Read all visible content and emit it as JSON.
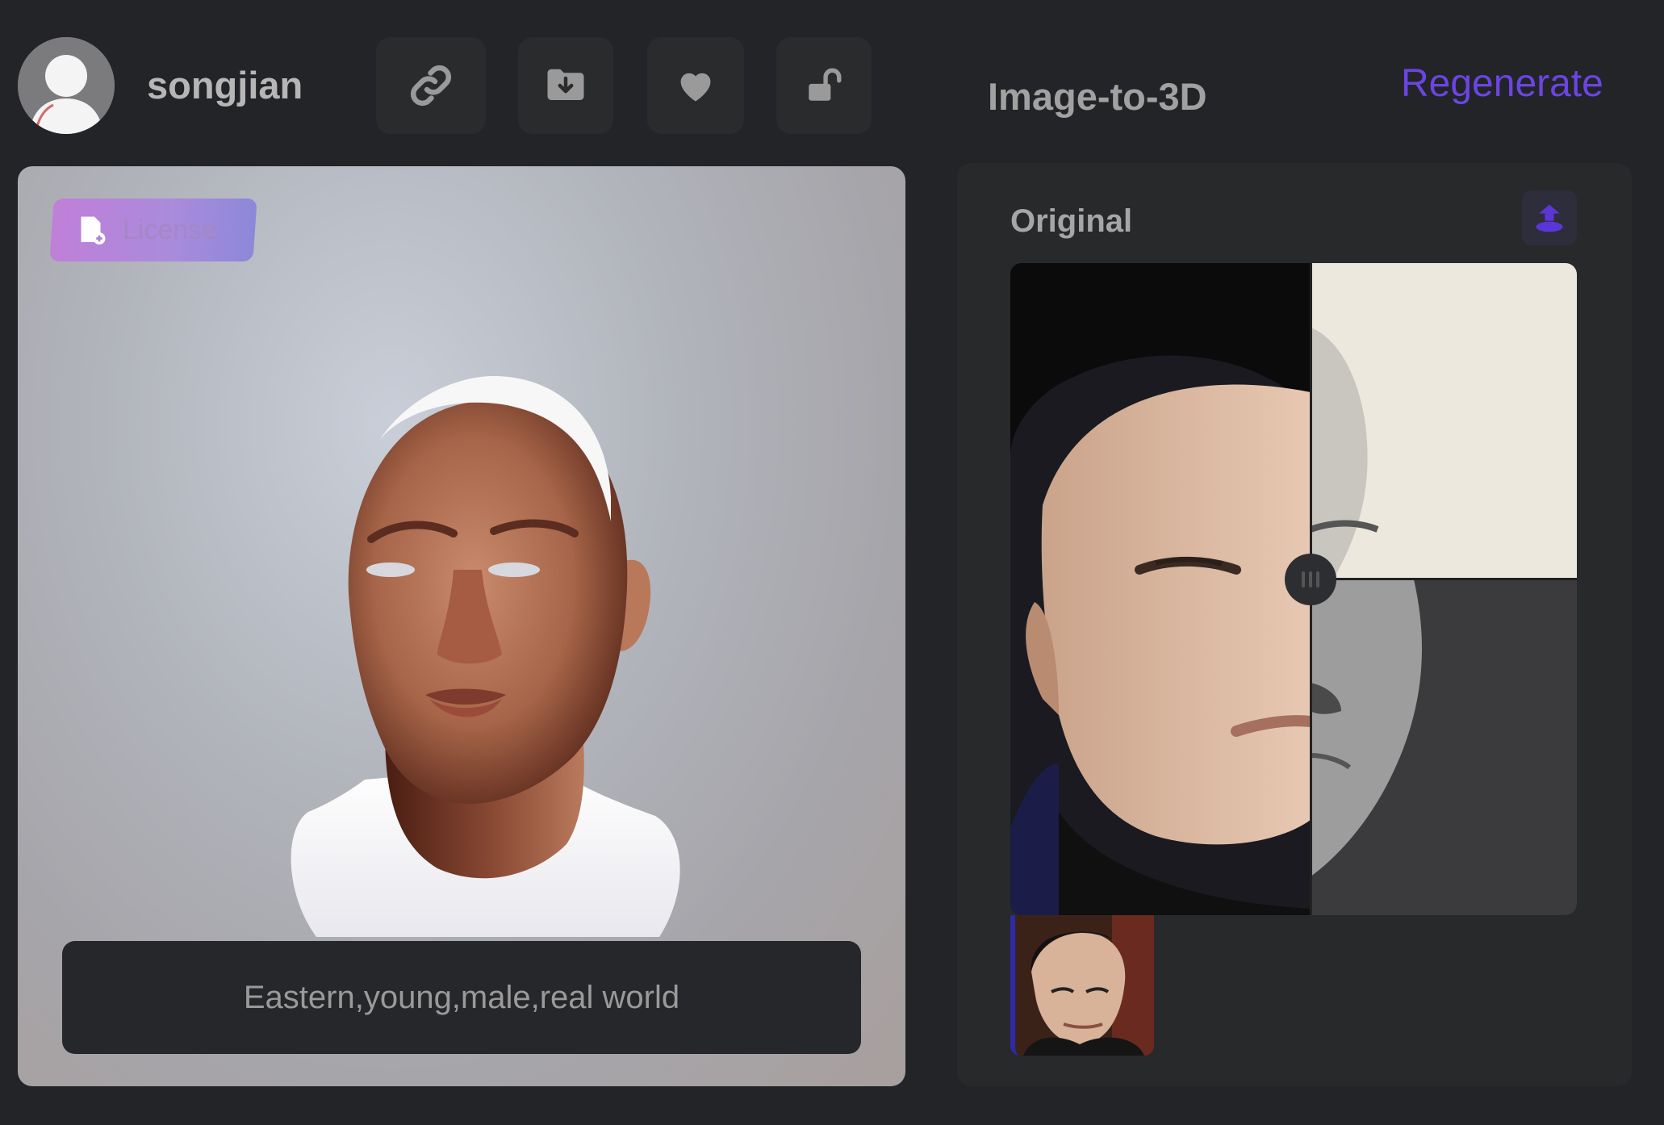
{
  "header": {
    "username": "songjian",
    "page_title": "Image-to-3D",
    "regenerate_label": "Regenerate",
    "toolbar_icons": [
      "link-icon",
      "download-folder-icon",
      "heart-icon",
      "unlock-icon"
    ]
  },
  "viewer": {
    "license_label": "License",
    "prompt_text": "Eastern,young,male,real world"
  },
  "panel": {
    "title": "Original",
    "upload_icon": "upload-icon",
    "slider_icon": "drag-handle-icon"
  },
  "colors": {
    "background": "#232427",
    "accent": "#6b45e3",
    "license_gradient_start": "#c07fd8",
    "license_gradient_end": "#8d88d8"
  }
}
